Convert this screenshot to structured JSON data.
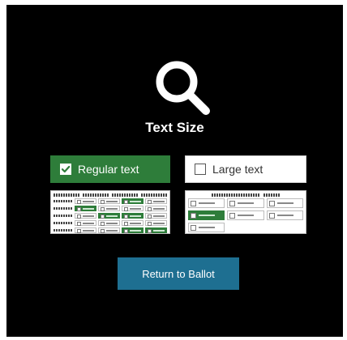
{
  "page": {
    "title": "Text Size"
  },
  "icons": {
    "header_icon": "search-icon",
    "checked_icon": "checkmark-icon"
  },
  "options": [
    {
      "label": "Regular text",
      "checked": true
    },
    {
      "label": "Large text",
      "checked": false
    }
  ],
  "actions": {
    "return_label": "Return to Ballot"
  },
  "colors": {
    "background": "#000000",
    "selected_option": "#2e7d3a",
    "primary_button": "#1e6f91",
    "text_light": "#ffffff"
  }
}
